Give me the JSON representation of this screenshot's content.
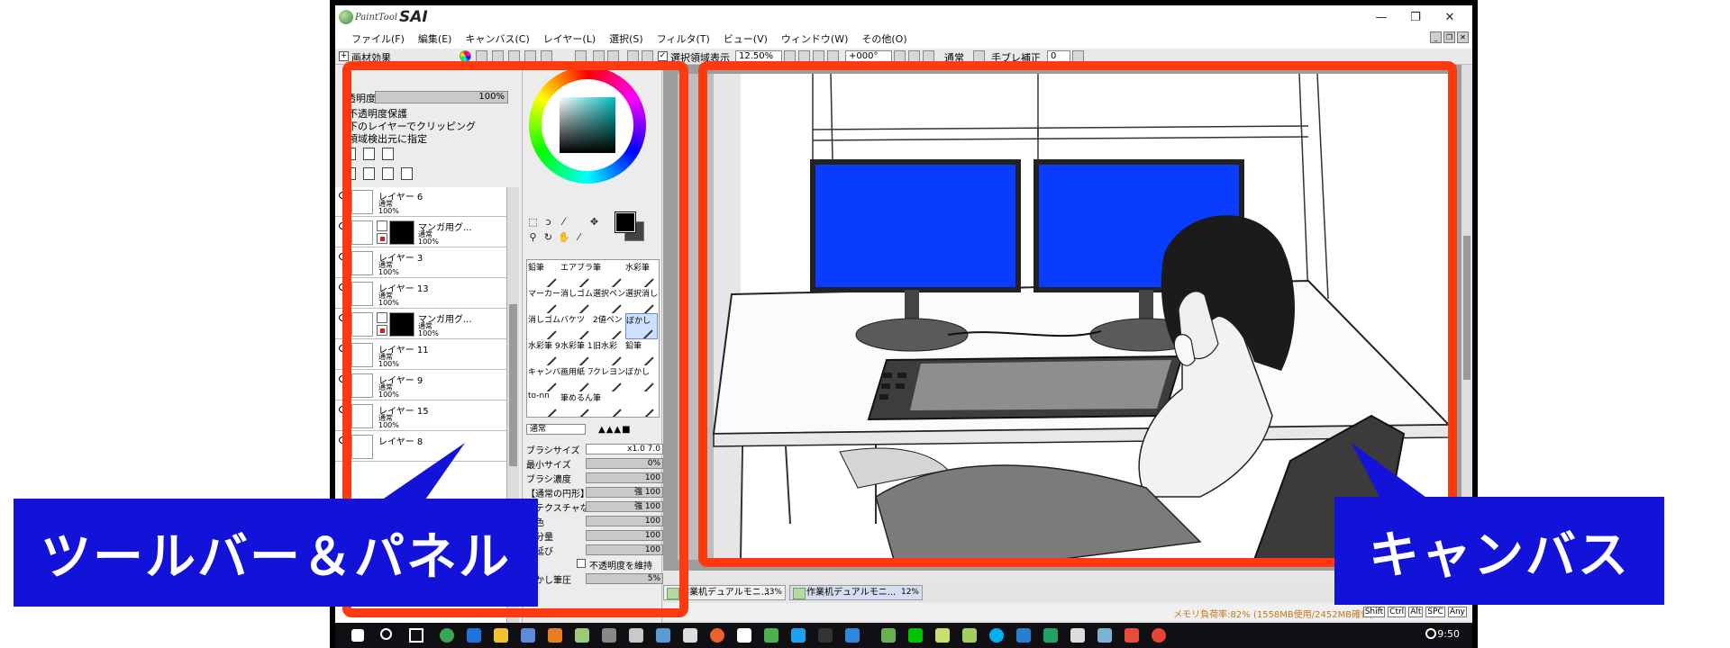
{
  "app": {
    "logo_small": "PaintTool",
    "logo_big": "SAI",
    "window_controls": [
      "—",
      "❐",
      "✕"
    ]
  },
  "menu": [
    "ファイル(F)",
    "編集(E)",
    "キャンバス(C)",
    "レイヤー(L)",
    "選択(S)",
    "フィルタ(T)",
    "ビュー(V)",
    "ウィンドウ(W)",
    "その他(O)"
  ],
  "toolbar": {
    "effects_label": "画材効果",
    "selection_display_label": "選択領域表示",
    "zoom": "12.50%",
    "rotation": "+000°",
    "blend": "通常",
    "stabilizer_label": "手ブレ補正",
    "stabilizer_value": "0"
  },
  "layer_panel": {
    "opacity_label": "透明度",
    "opacity_value": "100%",
    "option_preserve_opacity": "不透明度保護",
    "option_clipping": "下のレイヤーでクリッピング",
    "option_selection_source": "領域検出元に指定",
    "layers": [
      {
        "name": "レイヤー 6",
        "mode": "通常",
        "opacity": "100%",
        "mask": false
      },
      {
        "name": "マンガ用グ...",
        "mode": "通常",
        "opacity": "100%",
        "mask": true
      },
      {
        "name": "レイヤー 3",
        "mode": "通常",
        "opacity": "100%",
        "mask": false
      },
      {
        "name": "レイヤー 13",
        "mode": "通常",
        "opacity": "100%",
        "mask": false
      },
      {
        "name": "マンガ用グ...",
        "mode": "通常",
        "opacity": "100%",
        "mask": true
      },
      {
        "name": "レイヤー 11",
        "mode": "通常",
        "opacity": "100%",
        "mask": false
      },
      {
        "name": "レイヤー 9",
        "mode": "通常",
        "opacity": "100%",
        "mask": false
      },
      {
        "name": "レイヤー 15",
        "mode": "通常",
        "opacity": "100%",
        "mask": false
      },
      {
        "name": "レイヤー 8",
        "mode": "",
        "opacity": "",
        "mask": false
      }
    ]
  },
  "tool_panel": {
    "brushes": [
      "鉛筆",
      "エアブラシ",
      "筆",
      "水彩筆",
      "マーカー",
      "消しゴム",
      "選択ペン",
      "選択消し",
      "消しゴム",
      "バケツ",
      "2値ペン",
      "ぼかし",
      "水彩筆 9版",
      "水彩筆 10版",
      "旧水彩",
      "鉛筆",
      "キャンバス アクリル",
      "画用紙 アクリル",
      "クレヨン",
      "ぼかし",
      "to-nn",
      "筆めるん",
      "筆",
      ""
    ],
    "blend_mode": "通常",
    "props": [
      {
        "label": "ブラシサイズ",
        "value": "x1.0       7.0"
      },
      {
        "label": "最小サイズ",
        "value": "0%"
      },
      {
        "label": "ブラシ濃度",
        "value": "100"
      },
      {
        "label": "【通常の円形】",
        "value": "強   100"
      },
      {
        "label": "【テクスチャなし】",
        "value": "強   100"
      },
      {
        "label": "混色",
        "value": "100"
      },
      {
        "label": "水分量",
        "value": "100"
      },
      {
        "label": "色延び",
        "value": "100"
      },
      {
        "label": "不透明度を維持",
        "value": ""
      },
      {
        "label": "ぼかし筆圧",
        "value": "5%"
      }
    ]
  },
  "tabs": [
    {
      "name": "作業机デュアルモニ...",
      "zoom": "33%"
    },
    {
      "name": "作業机デュアルモニ...",
      "zoom": "12%"
    }
  ],
  "status": {
    "memory": "メモリ負荷率:82% (1558MB使用/2452MB確保)",
    "keys": [
      "Shift",
      "Ctrl",
      "Alt",
      "SPC",
      "Any"
    ]
  },
  "taskbar": {
    "clock": "9:50"
  },
  "callouts": {
    "left": "ツールバー＆パネル",
    "right": "キャンバス"
  },
  "colors": {
    "highlight": "#ff3a0f",
    "callout_bg": "#1212d8",
    "monitor_screen": "#0a3cff"
  }
}
